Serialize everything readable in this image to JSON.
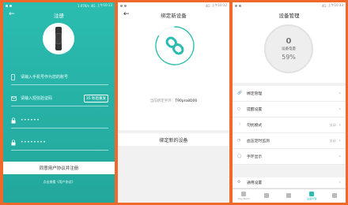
{
  "status_bar": {
    "left": "1.07K/s",
    "network": "4G",
    "p1_time": "上午10:13",
    "p2_time": "上午10:12",
    "p3_time": "上午10:13"
  },
  "register": {
    "title": "注册",
    "phone_placeholder": "请输入手机号作为您的账号",
    "code_placeholder": "请输入短信验证码",
    "code_button": "35 秒后重发",
    "password_mask": "••••••",
    "confirm_mask": "••••••••",
    "submit": "同意用户协议并注册",
    "footer_link": "点击查看《用户协议》"
  },
  "bind": {
    "title": "绑定新设备",
    "current_label": "当前绑定手环：",
    "current_device": "T90pro8D06",
    "bind_button": "绑定新的设备"
  },
  "device_mgmt": {
    "title": "设备管理",
    "battery_icon_char": "0",
    "battery_label": "设备电量",
    "battery_percent": "59%",
    "items": [
      {
        "label": "绑定管理",
        "value": "",
        "icon": "link-icon"
      },
      {
        "label": "提醒设置",
        "value": "",
        "icon": "bell-icon"
      },
      {
        "label": "勿扰模式",
        "value": "关闭",
        "icon": "moon-icon"
      },
      {
        "label": "血压定时监测",
        "value": "关闭",
        "icon": "clock-icon"
      },
      {
        "label": "手环显示",
        "value": "",
        "icon": "watch-icon"
      }
    ],
    "general": "通用设置",
    "tabs": [
      "Hey Band",
      "",
      "",
      "设备管理",
      ""
    ]
  },
  "colors": {
    "teal": "#2bbcb0",
    "frame": "#f0682a"
  }
}
